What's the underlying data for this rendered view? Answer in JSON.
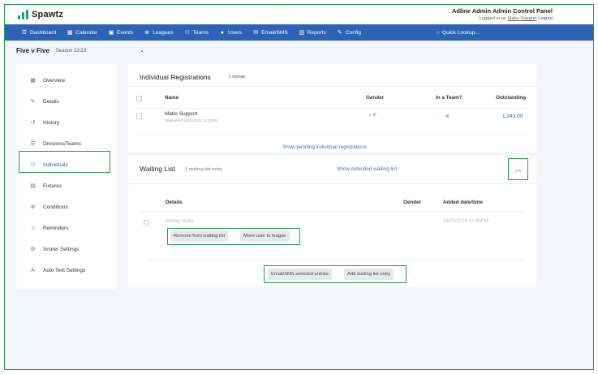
{
  "app": {
    "name": "Spawtz"
  },
  "account": {
    "title": "Adline Admin Admin Control Panel",
    "logged_in_prefix": "Logged in as",
    "user": "Matio Support",
    "logout": "Logout"
  },
  "nav": [
    {
      "label": "Dashboard",
      "icon": "layers-icon"
    },
    {
      "label": "Calendar",
      "icon": "calendar-icon"
    },
    {
      "label": "Events",
      "icon": "calendar-check-icon"
    },
    {
      "label": "Leagues",
      "icon": "trophy-icon"
    },
    {
      "label": "Teams",
      "icon": "users-icon"
    },
    {
      "label": "Users",
      "icon": "user-icon"
    },
    {
      "label": "Email/SMS",
      "icon": "envelope-icon"
    },
    {
      "label": "Reports",
      "icon": "chart-icon"
    },
    {
      "label": "Config",
      "icon": "wrench-icon"
    }
  ],
  "quick_lookup": "Quick Lookup...",
  "league": {
    "name": "Five v Five",
    "season": "Season 22/23"
  },
  "sidebar": [
    {
      "label": "Overview",
      "icon": "grid-icon"
    },
    {
      "label": "Details",
      "icon": "pencil-icon"
    },
    {
      "label": "History",
      "icon": "history-icon"
    },
    {
      "label": "Divisions/Teams",
      "icon": "list-icon"
    },
    {
      "label": "Individuals",
      "icon": "users-icon",
      "active": true
    },
    {
      "label": "Fixtures",
      "icon": "calendar-icon"
    },
    {
      "label": "Conditions",
      "icon": "globe-icon"
    },
    {
      "label": "Reminders",
      "icon": "bell-icon"
    },
    {
      "label": "Scorer Settings",
      "icon": "gears-icon"
    },
    {
      "label": "Auto Text Settings",
      "icon": "text-icon"
    }
  ],
  "registrations": {
    "title": "Individual Registrations",
    "count": "1 woman",
    "columns": [
      "Name",
      "Gender",
      "In a Team?",
      "Outstanding"
    ],
    "rows": [
      {
        "name": "Matio Support",
        "registered": "Registered 18/03/2024 12:23PM",
        "gender": "F",
        "outstanding": "1,243.00"
      }
    ],
    "pending_link": "Show pending individual registrations"
  },
  "waiting": {
    "title": "Waiting List",
    "count": "1 waiting list entry",
    "extended_link": "Show extended waiting list",
    "columns": [
      "Details",
      "Gender",
      "Added date/time"
    ],
    "rows": [
      {
        "name": "testing moilix",
        "added": "18/03/2024 12:40PM"
      }
    ],
    "remove_btn": "Remove from waiting list",
    "move_btn": "Move user to league",
    "email_btn": "Email/SMS selected entries",
    "add_btn": "Add waiting list entry"
  }
}
